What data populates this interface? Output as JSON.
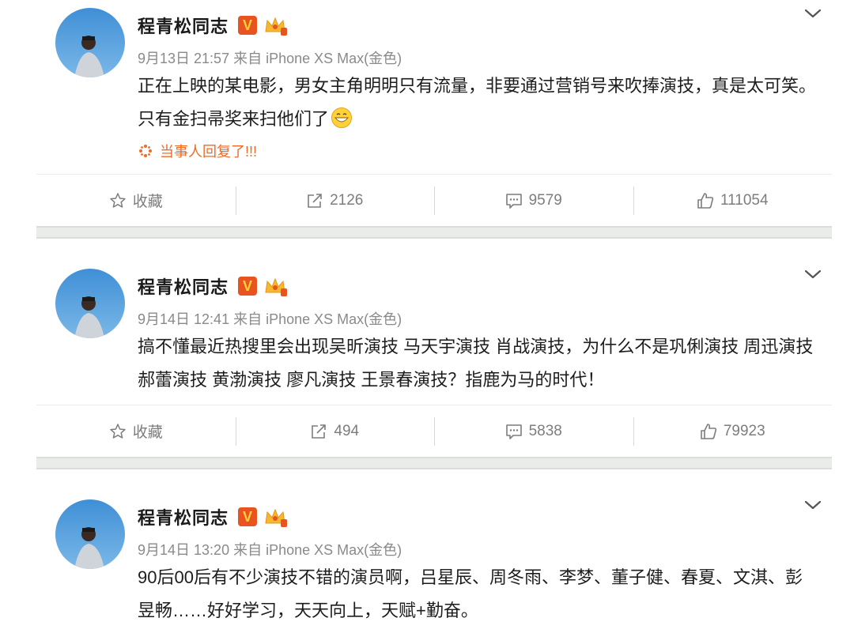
{
  "posts": [
    {
      "author": "程青松同志",
      "vip_badge": "V",
      "meta": "9月13日 21:57 来自 iPhone XS Max(金色)",
      "content": "正在上映的某电影，男女主角明明只有流量，非要通过营销号来吹捧演技，真是太可笑。只有金扫帚奖来扫他们了",
      "reply_text": "当事人回复了!!!",
      "actions": {
        "favorite": "收藏",
        "repost": "2126",
        "comment": "9579",
        "like": "111054"
      }
    },
    {
      "author": "程青松同志",
      "vip_badge": "V",
      "meta": "9月14日 12:41 来自 iPhone XS Max(金色)",
      "content": "搞不懂最近热搜里会出现吴昕演技 马天宇演技 肖战演技，为什么不是巩俐演技 周迅演技 郝蕾演技 黄渤演技 廖凡演技 王景春演技？指鹿为马的时代！",
      "actions": {
        "favorite": "收藏",
        "repost": "494",
        "comment": "5838",
        "like": "79923"
      }
    },
    {
      "author": "程青松同志",
      "vip_badge": "V",
      "meta": "9月14日 13:20 来自 iPhone XS Max(金色)",
      "content": "90后00后有不少演技不错的演员啊，吕星辰、周冬雨、李梦、董子健、春夏、文淇、彭昱畅……好好学习，天天向上，天赋+勤奋。"
    }
  ],
  "colors": {
    "badge": "#e8531f",
    "reply": "#f06a23",
    "separator": "#e9ece9"
  },
  "icons": [
    "avatar-photo",
    "vip-badge",
    "crown-icon",
    "chevron-down-icon",
    "grin-emoji",
    "sparkle-icon",
    "star-icon",
    "share-icon",
    "comment-icon",
    "thumbs-up-icon"
  ]
}
